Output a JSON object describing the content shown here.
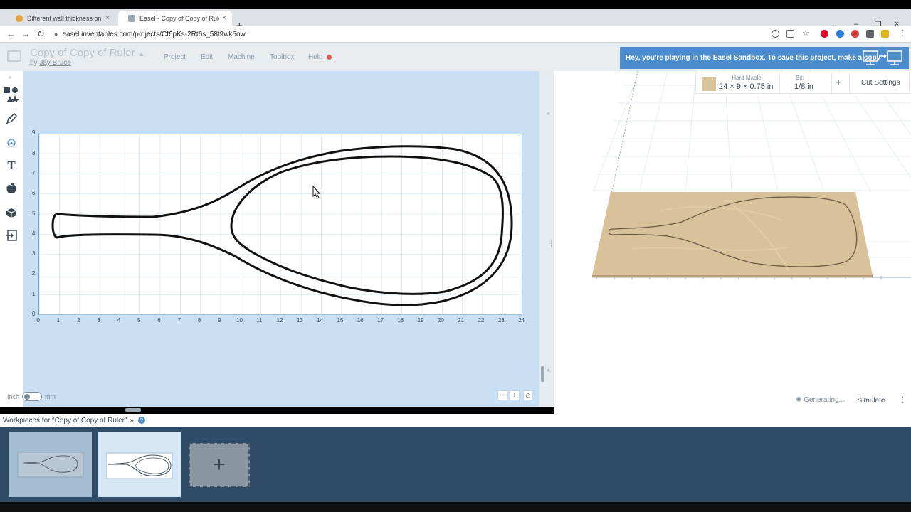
{
  "browser": {
    "tabs": [
      {
        "title": "Different wall thickness on fly fish",
        "close": "×"
      },
      {
        "title": "Easel - Copy of Copy of Ruler",
        "close": "×"
      }
    ],
    "new_tab": "+",
    "url": "easel.inventables.com/projects/Cf6pKs-2Rt6s_58t9wk5ow",
    "nav_icons": {
      "back": "←",
      "forward": "→",
      "reload": "↻",
      "lock": "🔒"
    },
    "window_controls": [
      "⌄",
      "–",
      "❐",
      "×"
    ]
  },
  "app": {
    "project_title": "Copy of Copy of Ruler",
    "by_prefix": "by",
    "author": "Jay Bruce",
    "menus": [
      "Project",
      "Edit",
      "Machine",
      "Toolbox",
      "Help"
    ],
    "sandbox_notice": "Hey, you're playing in the Easel Sandbox. To save this project, make a copy",
    "accent": "#4a8ccc"
  },
  "canvas": {
    "y_ticks": [
      "0",
      "1",
      "2",
      "3",
      "4",
      "5",
      "6",
      "7",
      "8",
      "9"
    ],
    "x_ticks": [
      "0",
      "1",
      "2",
      "3",
      "4",
      "5",
      "6",
      "7",
      "8",
      "9",
      "10",
      "11",
      "12",
      "13",
      "14",
      "15",
      "16",
      "17",
      "18",
      "19",
      "20",
      "21",
      "22",
      "23",
      "24"
    ],
    "unit_left": "Inch",
    "unit_right": "mm",
    "zoom_out": "−",
    "zoom_in": "+",
    "home": "⌂"
  },
  "tools": [
    "shapes-icon",
    "pen-icon",
    "target-icon",
    "text-icon",
    "apple-icon",
    "box-icon",
    "import-icon"
  ],
  "material": {
    "name": "Hard Maple",
    "dims": "24 × 9 × 0.75 in",
    "bit_label": "Bit:",
    "bit_value": "1/8 in",
    "add": "+",
    "cut_settings": "Cut Settings"
  },
  "preview": {
    "generating": "Generating...",
    "simulate": "Simulate",
    "menu": "⋮"
  },
  "workpieces": {
    "label": "Workpieces for “Copy of Copy of Ruler”",
    "chevron": "»",
    "help": "?",
    "add": "+"
  }
}
